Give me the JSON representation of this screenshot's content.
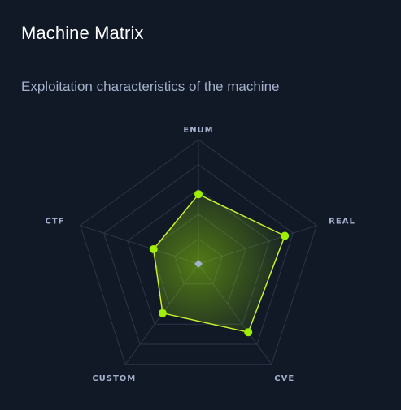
{
  "header": {
    "title": "Machine Matrix",
    "subtitle": "Exploitation characteristics of the machine"
  },
  "chart_data": {
    "type": "radar",
    "axes": [
      "ENUM",
      "REAL",
      "CVE",
      "CUSTOM",
      "CTF"
    ],
    "values": [
      5.6,
      7.3,
      6.8,
      4.9,
      3.8
    ],
    "max": 10,
    "levels": 5,
    "colors": {
      "background": "#111927",
      "grid": "#2c3648",
      "line": "#c9f02c",
      "fill": "#9fef00",
      "point": "#9fef00",
      "center": "#a4b1cd",
      "label": "#a4b1cd"
    }
  }
}
